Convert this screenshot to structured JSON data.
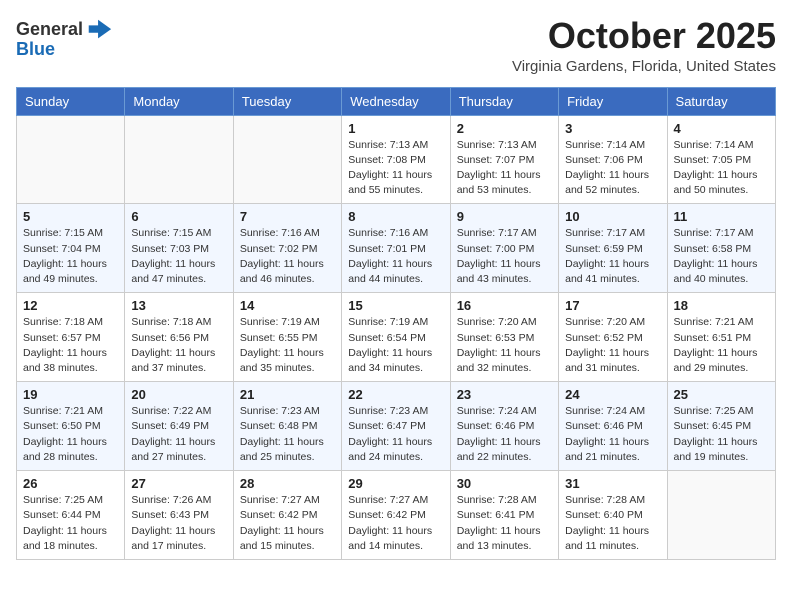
{
  "header": {
    "logo_line1": "General",
    "logo_line2": "Blue",
    "month": "October 2025",
    "location": "Virginia Gardens, Florida, United States"
  },
  "weekdays": [
    "Sunday",
    "Monday",
    "Tuesday",
    "Wednesday",
    "Thursday",
    "Friday",
    "Saturday"
  ],
  "weeks": [
    [
      {
        "day": "",
        "info": ""
      },
      {
        "day": "",
        "info": ""
      },
      {
        "day": "",
        "info": ""
      },
      {
        "day": "1",
        "info": "Sunrise: 7:13 AM\nSunset: 7:08 PM\nDaylight: 11 hours\nand 55 minutes."
      },
      {
        "day": "2",
        "info": "Sunrise: 7:13 AM\nSunset: 7:07 PM\nDaylight: 11 hours\nand 53 minutes."
      },
      {
        "day": "3",
        "info": "Sunrise: 7:14 AM\nSunset: 7:06 PM\nDaylight: 11 hours\nand 52 minutes."
      },
      {
        "day": "4",
        "info": "Sunrise: 7:14 AM\nSunset: 7:05 PM\nDaylight: 11 hours\nand 50 minutes."
      }
    ],
    [
      {
        "day": "5",
        "info": "Sunrise: 7:15 AM\nSunset: 7:04 PM\nDaylight: 11 hours\nand 49 minutes."
      },
      {
        "day": "6",
        "info": "Sunrise: 7:15 AM\nSunset: 7:03 PM\nDaylight: 11 hours\nand 47 minutes."
      },
      {
        "day": "7",
        "info": "Sunrise: 7:16 AM\nSunset: 7:02 PM\nDaylight: 11 hours\nand 46 minutes."
      },
      {
        "day": "8",
        "info": "Sunrise: 7:16 AM\nSunset: 7:01 PM\nDaylight: 11 hours\nand 44 minutes."
      },
      {
        "day": "9",
        "info": "Sunrise: 7:17 AM\nSunset: 7:00 PM\nDaylight: 11 hours\nand 43 minutes."
      },
      {
        "day": "10",
        "info": "Sunrise: 7:17 AM\nSunset: 6:59 PM\nDaylight: 11 hours\nand 41 minutes."
      },
      {
        "day": "11",
        "info": "Sunrise: 7:17 AM\nSunset: 6:58 PM\nDaylight: 11 hours\nand 40 minutes."
      }
    ],
    [
      {
        "day": "12",
        "info": "Sunrise: 7:18 AM\nSunset: 6:57 PM\nDaylight: 11 hours\nand 38 minutes."
      },
      {
        "day": "13",
        "info": "Sunrise: 7:18 AM\nSunset: 6:56 PM\nDaylight: 11 hours\nand 37 minutes."
      },
      {
        "day": "14",
        "info": "Sunrise: 7:19 AM\nSunset: 6:55 PM\nDaylight: 11 hours\nand 35 minutes."
      },
      {
        "day": "15",
        "info": "Sunrise: 7:19 AM\nSunset: 6:54 PM\nDaylight: 11 hours\nand 34 minutes."
      },
      {
        "day": "16",
        "info": "Sunrise: 7:20 AM\nSunset: 6:53 PM\nDaylight: 11 hours\nand 32 minutes."
      },
      {
        "day": "17",
        "info": "Sunrise: 7:20 AM\nSunset: 6:52 PM\nDaylight: 11 hours\nand 31 minutes."
      },
      {
        "day": "18",
        "info": "Sunrise: 7:21 AM\nSunset: 6:51 PM\nDaylight: 11 hours\nand 29 minutes."
      }
    ],
    [
      {
        "day": "19",
        "info": "Sunrise: 7:21 AM\nSunset: 6:50 PM\nDaylight: 11 hours\nand 28 minutes."
      },
      {
        "day": "20",
        "info": "Sunrise: 7:22 AM\nSunset: 6:49 PM\nDaylight: 11 hours\nand 27 minutes."
      },
      {
        "day": "21",
        "info": "Sunrise: 7:23 AM\nSunset: 6:48 PM\nDaylight: 11 hours\nand 25 minutes."
      },
      {
        "day": "22",
        "info": "Sunrise: 7:23 AM\nSunset: 6:47 PM\nDaylight: 11 hours\nand 24 minutes."
      },
      {
        "day": "23",
        "info": "Sunrise: 7:24 AM\nSunset: 6:46 PM\nDaylight: 11 hours\nand 22 minutes."
      },
      {
        "day": "24",
        "info": "Sunrise: 7:24 AM\nSunset: 6:46 PM\nDaylight: 11 hours\nand 21 minutes."
      },
      {
        "day": "25",
        "info": "Sunrise: 7:25 AM\nSunset: 6:45 PM\nDaylight: 11 hours\nand 19 minutes."
      }
    ],
    [
      {
        "day": "26",
        "info": "Sunrise: 7:25 AM\nSunset: 6:44 PM\nDaylight: 11 hours\nand 18 minutes."
      },
      {
        "day": "27",
        "info": "Sunrise: 7:26 AM\nSunset: 6:43 PM\nDaylight: 11 hours\nand 17 minutes."
      },
      {
        "day": "28",
        "info": "Sunrise: 7:27 AM\nSunset: 6:42 PM\nDaylight: 11 hours\nand 15 minutes."
      },
      {
        "day": "29",
        "info": "Sunrise: 7:27 AM\nSunset: 6:42 PM\nDaylight: 11 hours\nand 14 minutes."
      },
      {
        "day": "30",
        "info": "Sunrise: 7:28 AM\nSunset: 6:41 PM\nDaylight: 11 hours\nand 13 minutes."
      },
      {
        "day": "31",
        "info": "Sunrise: 7:28 AM\nSunset: 6:40 PM\nDaylight: 11 hours\nand 11 minutes."
      },
      {
        "day": "",
        "info": ""
      }
    ]
  ]
}
